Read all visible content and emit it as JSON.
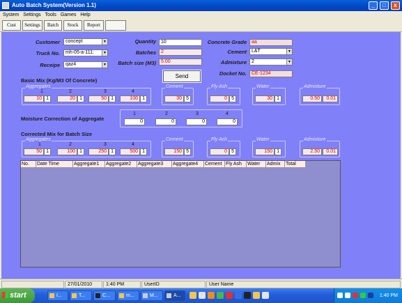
{
  "window": {
    "title": "Auto Batch System(Version 1.1)",
    "minimize": "_",
    "maximize": "□",
    "close": "x"
  },
  "menu": [
    "System",
    "Settings",
    "Tools",
    "Games",
    "Help"
  ],
  "toolbar": [
    "Cust",
    "Settings",
    "Batch",
    "Stock",
    "Report",
    ""
  ],
  "form": {
    "customer_label": "Customer",
    "customer_value": "concept",
    "truck_label": "Truck No.",
    "truck_value": "mh-05-a-111:",
    "receipe_label": "Receipe",
    "receipe_value": "qaz4",
    "quantity_label": "Quantity",
    "quantity_value": "10",
    "batches_label": "Batches",
    "batches_value": "2",
    "batch_size_label": "Batch size (M3)",
    "batch_size_value": "5.00",
    "send_label": "Send",
    "grade_label": "Concrete Grade",
    "grade_value": "aa",
    "cement_label": "Cement",
    "cement_value": "L&T",
    "admixture_label": "Admixture",
    "admixture_value": "2",
    "docket_label": "Docket No.",
    "docket_value": "CE-1234"
  },
  "basic_mix": {
    "title": "Basic Mix (Kg/M3 Of Concrete)",
    "aggregates_label": "Aggregates",
    "aggregates": [
      {
        "index": "1",
        "value": "10",
        "sub": "1"
      },
      {
        "index": "2",
        "value": "20",
        "sub": "1"
      },
      {
        "index": "3",
        "value": "50",
        "sub": "1"
      },
      {
        "index": "4",
        "value": "100",
        "sub": "1"
      }
    ],
    "cement_label": "Cement",
    "cement_value": "30",
    "cement_sub": "5",
    "flyash_label": "Fly Ash",
    "flyash_value": "0",
    "flyash_sub": "5",
    "water_label": "Water",
    "water_value": "30",
    "water_sub": "1",
    "admixture_label": "Admixture",
    "admixture_value": "0.50",
    "admixture_sub": "0.01"
  },
  "moisture": {
    "title": "Moisture Correction of Aggregate",
    "cols": [
      {
        "index": "1",
        "value": "0"
      },
      {
        "index": "2",
        "value": "0"
      },
      {
        "index": "3",
        "value": "0"
      },
      {
        "index": "4",
        "value": "0"
      }
    ]
  },
  "corrected_mix": {
    "title": "Corrected Mix for Batch Size",
    "aggregates_label": "Aggregates",
    "aggregates": [
      {
        "index": "1",
        "value": "50",
        "sub": "1"
      },
      {
        "index": "2",
        "value": "100",
        "sub": "1"
      },
      {
        "index": "3",
        "value": "250",
        "sub": "1"
      },
      {
        "index": "4",
        "value": "500",
        "sub": "1"
      }
    ],
    "cement_label": "Cement",
    "cement_value": "150",
    "cement_sub": "5",
    "flyash_label": "Fly Ash",
    "flyash_value": "0",
    "flyash_sub": "5",
    "water_label": "Water",
    "water_value": "150",
    "water_sub": "1",
    "admixture_label": "Admixture",
    "admixture_value": "2.50",
    "admixture_sub": "0.01"
  },
  "grid": {
    "columns": [
      "No.",
      "Date Time",
      "Aggregate1",
      "Aggregate2",
      "Aggregate3",
      "Aggregate4",
      "Cement",
      "Fly Ash",
      "Water",
      "Admix",
      "Total"
    ]
  },
  "status": {
    "date": "27/01/2010",
    "time": "1:40 PM",
    "user_id": "UserID",
    "user_name": "User Name"
  },
  "taskbar": {
    "start": "start",
    "tasks": [
      "I...",
      "T...",
      "C...",
      "m...",
      "M...",
      "A..."
    ],
    "clock": "1:40 PM"
  },
  "colors": {
    "main_bg": "#8080f8",
    "value_red": "#e00000",
    "titlebar": "#0046c7"
  }
}
